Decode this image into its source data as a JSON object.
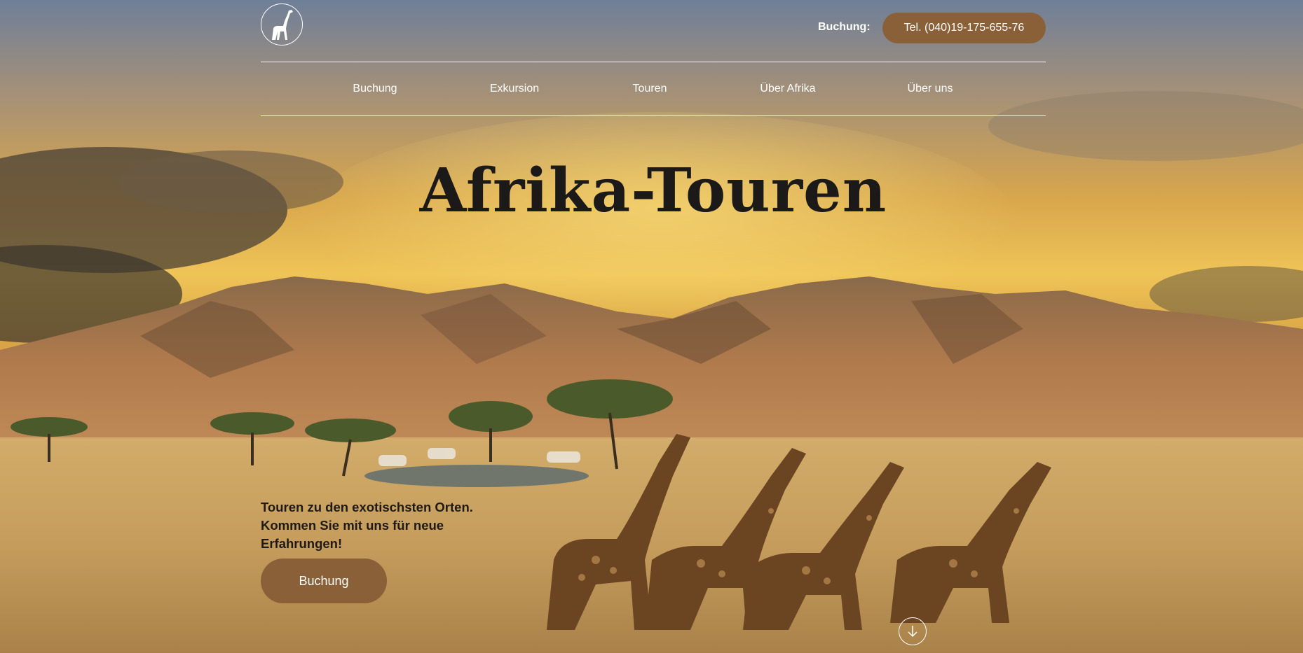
{
  "header": {
    "logo_icon": "giraffe-icon",
    "booking_label": "Buchung:",
    "phone_button": "Tel. (040)19-175-655-76"
  },
  "nav": {
    "items": [
      {
        "label": "Buchung"
      },
      {
        "label": "Exkursion"
      },
      {
        "label": "Touren"
      },
      {
        "label": "Über Afrika"
      },
      {
        "label": "Über uns"
      }
    ]
  },
  "hero": {
    "title": "Afrika-Touren",
    "tagline_lines": [
      "Touren zu den exotischsten Orten.",
      "Kommen Sie mit uns für neue",
      "Erfahrungen!"
    ],
    "cta_label": "Buchung",
    "scroll_icon": "arrow-down-icon"
  },
  "colors": {
    "accent": "#8a6038",
    "title_text": "#1c1a18"
  }
}
